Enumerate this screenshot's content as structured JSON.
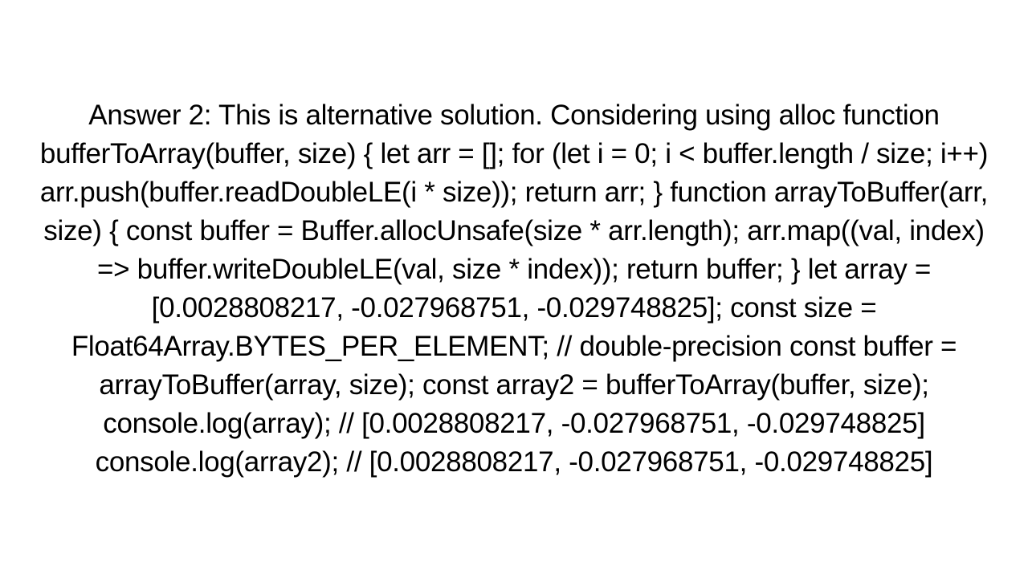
{
  "answer": {
    "text": "Answer 2: This is alternative solution. Considering using alloc  function bufferToArray(buffer, size) {     let arr = [];     for (let i = 0; i < buffer.length / size; i++) arr.push(buffer.readDoubleLE(i * size));     return arr;   }   function arrayToBuffer(arr, size) {     const buffer = Buffer.allocUnsafe(size * arr.length);     arr.map((val, index) => buffer.writeDoubleLE(val, size * index));     return buffer;   }    let array = [0.0028808217, -0.027968751, -0.029748825];   const size = Float64Array.BYTES_PER_ELEMENT; // double-precision    const buffer = arrayToBuffer(array, size);   const array2 = bufferToArray(buffer, size);    console.log(array); // [0.0028808217, -0.027968751, -0.029748825]   console.log(array2); // [0.0028808217, -0.027968751, -0.029748825]"
  }
}
